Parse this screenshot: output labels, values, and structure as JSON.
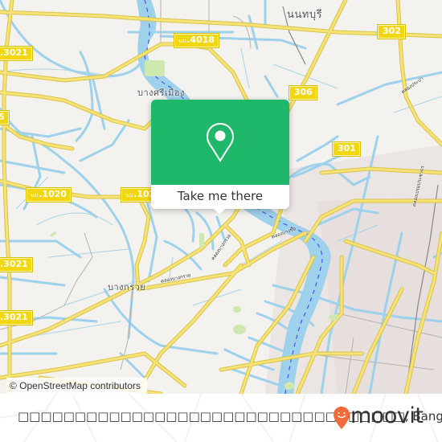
{
  "map": {
    "route_shields": [
      {
        "prefix": "",
        "number": "302"
      },
      {
        "prefix": "นบ",
        "number": ".4018"
      },
      {
        "prefix": "",
        "number": ".3021"
      },
      {
        "prefix": "",
        "number": "306"
      },
      {
        "prefix": "",
        "number": "5"
      },
      {
        "prefix": "",
        "number": "301"
      },
      {
        "prefix": "นบ",
        "number": ".1020"
      },
      {
        "prefix": "นบ",
        "number": ".102"
      },
      {
        "prefix": "",
        "number": ".3021"
      },
      {
        "prefix": "",
        "number": ".3021"
      }
    ],
    "place_labels": [
      "นนทบุรี",
      "บางศรีเมือง",
      "บางกรวย"
    ],
    "canal_labels": [
      "คลองบางกรวย",
      "คลองบางกรวย",
      "คลองบางซื่อ",
      "คลองประปา",
      "คลองเปรมประชากร"
    ],
    "attribution": "© OpenStreetMap contributors"
  },
  "popup": {
    "icon": "map-pin-icon",
    "cta_label": "Take me there",
    "accent_color": "#1fb76a"
  },
  "footer": {
    "place_name": "□□□□□□□□□□□□□□□□□□□□□□□□□□□□□□□□□□, Bangkok",
    "brand": "moovit",
    "brand_color": "#f26b3a"
  }
}
